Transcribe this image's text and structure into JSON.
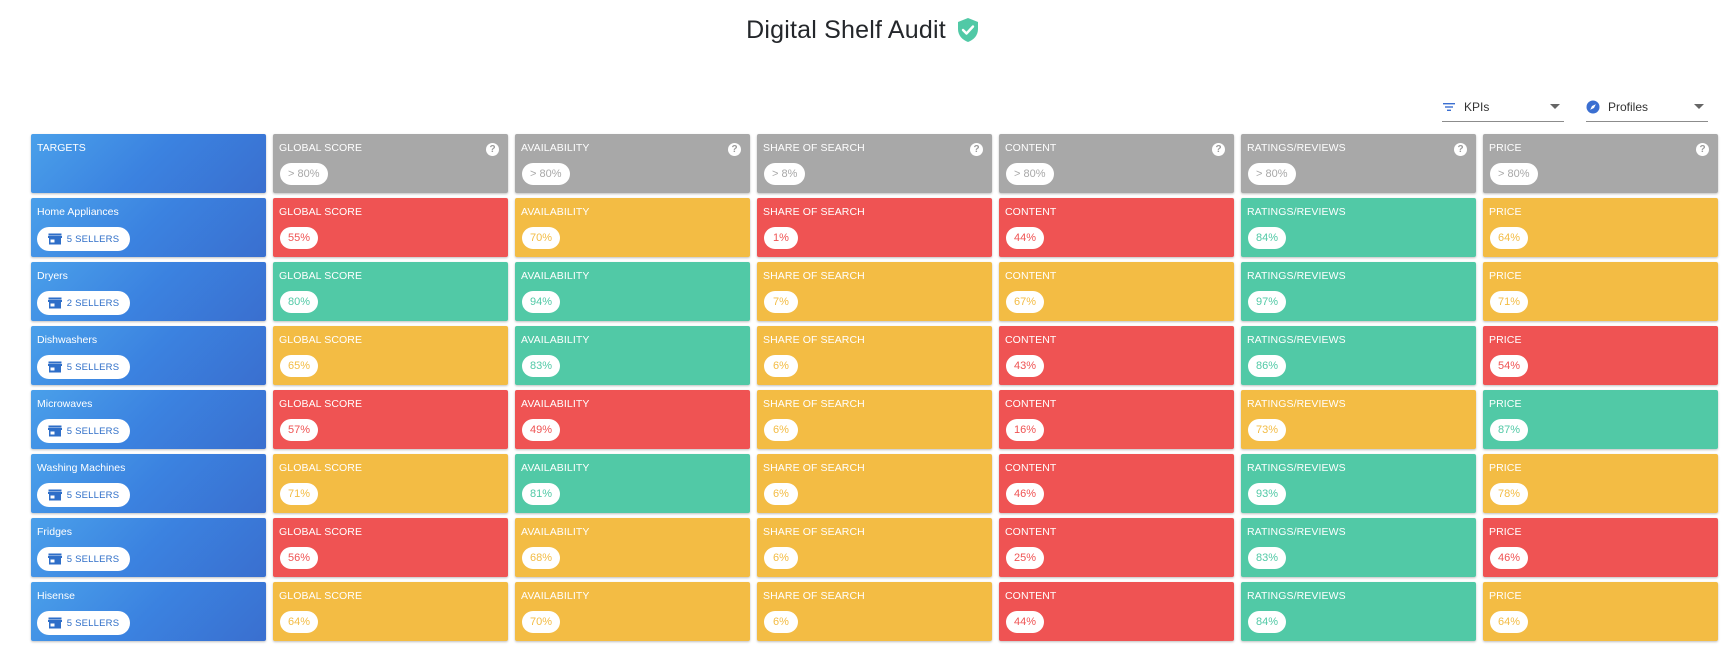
{
  "page": {
    "title": "Digital Shelf Audit"
  },
  "filters": {
    "kpis": {
      "label": "KPIs"
    },
    "profiles": {
      "label": "Profiles"
    }
  },
  "colors": {
    "red": "#ef5353",
    "yellow": "#f3bc44",
    "green": "#51c9a6",
    "grey": "#a8a8a8",
    "blue": "#3b82e0",
    "verified": "#51c9a6"
  },
  "targets": {
    "label": "TARGETS",
    "cells": [
      {
        "label": "GLOBAL SCORE",
        "value": "> 80%"
      },
      {
        "label": "AVAILABILITY",
        "value": "> 80%"
      },
      {
        "label": "SHARE OF SEARCH",
        "value": "> 8%"
      },
      {
        "label": "CONTENT",
        "value": "> 80%"
      },
      {
        "label": "RATINGS/REVIEWS",
        "value": "> 80%"
      },
      {
        "label": "PRICE",
        "value": "> 80%"
      }
    ]
  },
  "rows": [
    {
      "name": "Home Appliances",
      "sellers": "5 SELLERS",
      "cells": [
        {
          "label": "GLOBAL SCORE",
          "value": "55%",
          "status": "red"
        },
        {
          "label": "AVAILABILITY",
          "value": "70%",
          "status": "yellow"
        },
        {
          "label": "SHARE OF SEARCH",
          "value": "1%",
          "status": "red"
        },
        {
          "label": "CONTENT",
          "value": "44%",
          "status": "red"
        },
        {
          "label": "RATINGS/REVIEWS",
          "value": "84%",
          "status": "green"
        },
        {
          "label": "PRICE",
          "value": "64%",
          "status": "yellow"
        }
      ]
    },
    {
      "name": "Dryers",
      "sellers": "2 SELLERS",
      "cells": [
        {
          "label": "GLOBAL SCORE",
          "value": "80%",
          "status": "green"
        },
        {
          "label": "AVAILABILITY",
          "value": "94%",
          "status": "green"
        },
        {
          "label": "SHARE OF SEARCH",
          "value": "7%",
          "status": "yellow"
        },
        {
          "label": "CONTENT",
          "value": "67%",
          "status": "yellow"
        },
        {
          "label": "RATINGS/REVIEWS",
          "value": "97%",
          "status": "green"
        },
        {
          "label": "PRICE",
          "value": "71%",
          "status": "yellow"
        }
      ]
    },
    {
      "name": "Dishwashers",
      "sellers": "5 SELLERS",
      "cells": [
        {
          "label": "GLOBAL SCORE",
          "value": "65%",
          "status": "yellow"
        },
        {
          "label": "AVAILABILITY",
          "value": "83%",
          "status": "green"
        },
        {
          "label": "SHARE OF SEARCH",
          "value": "6%",
          "status": "yellow"
        },
        {
          "label": "CONTENT",
          "value": "43%",
          "status": "red"
        },
        {
          "label": "RATINGS/REVIEWS",
          "value": "86%",
          "status": "green"
        },
        {
          "label": "PRICE",
          "value": "54%",
          "status": "red"
        }
      ]
    },
    {
      "name": "Microwaves",
      "sellers": "5 SELLERS",
      "cells": [
        {
          "label": "GLOBAL SCORE",
          "value": "57%",
          "status": "red"
        },
        {
          "label": "AVAILABILITY",
          "value": "49%",
          "status": "red"
        },
        {
          "label": "SHARE OF SEARCH",
          "value": "6%",
          "status": "yellow"
        },
        {
          "label": "CONTENT",
          "value": "16%",
          "status": "red"
        },
        {
          "label": "RATINGS/REVIEWS",
          "value": "73%",
          "status": "yellow"
        },
        {
          "label": "PRICE",
          "value": "87%",
          "status": "green"
        }
      ]
    },
    {
      "name": "Washing Machines",
      "sellers": "5 SELLERS",
      "cells": [
        {
          "label": "GLOBAL SCORE",
          "value": "71%",
          "status": "yellow"
        },
        {
          "label": "AVAILABILITY",
          "value": "81%",
          "status": "green"
        },
        {
          "label": "SHARE OF SEARCH",
          "value": "6%",
          "status": "yellow"
        },
        {
          "label": "CONTENT",
          "value": "46%",
          "status": "red"
        },
        {
          "label": "RATINGS/REVIEWS",
          "value": "93%",
          "status": "green"
        },
        {
          "label": "PRICE",
          "value": "78%",
          "status": "yellow"
        }
      ]
    },
    {
      "name": "Fridges",
      "sellers": "5 SELLERS",
      "cells": [
        {
          "label": "GLOBAL SCORE",
          "value": "56%",
          "status": "red"
        },
        {
          "label": "AVAILABILITY",
          "value": "68%",
          "status": "yellow"
        },
        {
          "label": "SHARE OF SEARCH",
          "value": "6%",
          "status": "yellow"
        },
        {
          "label": "CONTENT",
          "value": "25%",
          "status": "red"
        },
        {
          "label": "RATINGS/REVIEWS",
          "value": "83%",
          "status": "green"
        },
        {
          "label": "PRICE",
          "value": "46%",
          "status": "red"
        }
      ]
    },
    {
      "name": "Hisense",
      "sellers": "5 SELLERS",
      "cells": [
        {
          "label": "GLOBAL SCORE",
          "value": "64%",
          "status": "yellow"
        },
        {
          "label": "AVAILABILITY",
          "value": "70%",
          "status": "yellow"
        },
        {
          "label": "SHARE OF SEARCH",
          "value": "6%",
          "status": "yellow"
        },
        {
          "label": "CONTENT",
          "value": "44%",
          "status": "red"
        },
        {
          "label": "RATINGS/REVIEWS",
          "value": "84%",
          "status": "green"
        },
        {
          "label": "PRICE",
          "value": "64%",
          "status": "yellow"
        }
      ]
    }
  ]
}
